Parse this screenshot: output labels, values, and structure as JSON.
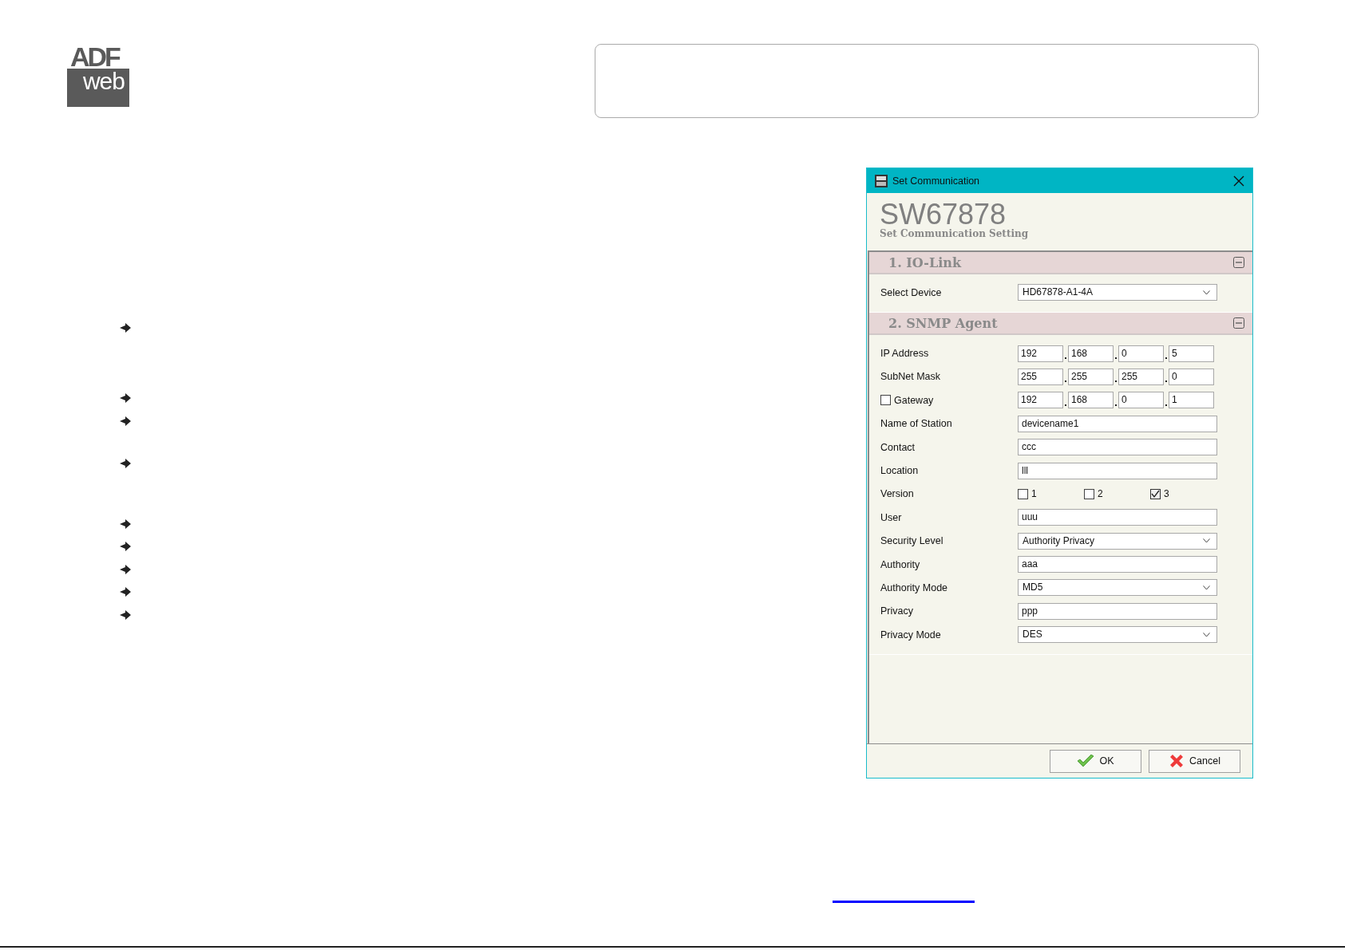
{
  "logo": {
    "top": "ADF",
    "bottom": "web"
  },
  "dialog": {
    "title": "Set Communication",
    "heading": "SW67878",
    "subtitle": "Set Communication Setting",
    "sections": [
      {
        "title": "1. IO-Link",
        "expanded": true,
        "rows": [
          {
            "kind": "select",
            "label": "Select Device",
            "value": "HD67878-A1-4A"
          }
        ]
      },
      {
        "title": "2. SNMP Agent",
        "expanded": true,
        "rows": [
          {
            "kind": "ip",
            "label": "IP Address",
            "octets": [
              "192",
              "168",
              "0",
              "5"
            ]
          },
          {
            "kind": "ip",
            "label": "SubNet Mask",
            "octets": [
              "255",
              "255",
              "255",
              "0"
            ]
          },
          {
            "kind": "ip_check",
            "label": "Gateway",
            "checked": false,
            "octets": [
              "192",
              "168",
              "0",
              "1"
            ]
          },
          {
            "kind": "text",
            "label": "Name of Station",
            "value": "devicename1"
          },
          {
            "kind": "text",
            "label": "Contact",
            "value": "ccc"
          },
          {
            "kind": "text",
            "label": "Location",
            "value": "lll"
          },
          {
            "kind": "checks",
            "label": "Version",
            "options": [
              {
                "label": "1",
                "checked": false
              },
              {
                "label": "2",
                "checked": false
              },
              {
                "label": "3",
                "checked": true
              }
            ]
          },
          {
            "kind": "text",
            "label": "User",
            "value": "uuu"
          },
          {
            "kind": "select",
            "label": "Security Level",
            "value": "Authority Privacy"
          },
          {
            "kind": "text",
            "label": "Authority",
            "value": "aaa"
          },
          {
            "kind": "select",
            "label": "Authority Mode",
            "value": "MD5"
          },
          {
            "kind": "text",
            "label": "Privacy",
            "value": "ppp"
          },
          {
            "kind": "select",
            "label": "Privacy Mode",
            "value": "DES"
          }
        ]
      }
    ],
    "buttons": [
      {
        "kind": "ok",
        "label": "OK"
      },
      {
        "kind": "cancel",
        "label": "Cancel"
      }
    ]
  }
}
